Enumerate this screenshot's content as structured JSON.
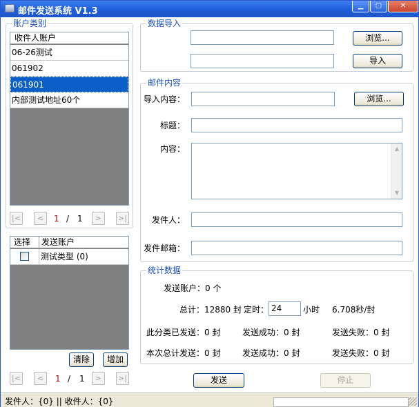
{
  "window": {
    "title": "邮件发送系统 V1.3",
    "controls": [
      "▁",
      "▢",
      "✕"
    ]
  },
  "account_category": {
    "label": "账户类别",
    "column": "收件人账户",
    "rows": [
      "06-26测试",
      "061902",
      "061901",
      "内部测试地址60个"
    ],
    "selected_index": 2,
    "pager": {
      "first": "|<",
      "prev": "<",
      "current": "1",
      "sep": "/",
      "total": "1",
      "next": ">",
      "last": ">|"
    }
  },
  "send_accounts": {
    "col_select": "选择",
    "col_account": "发送账户",
    "rows": [
      {
        "checked": false,
        "name": "测试类型 (0)"
      }
    ],
    "clear_label": "清除",
    "add_label": "增加",
    "pager": {
      "first": "|<",
      "prev": "<",
      "current": "1",
      "sep": "/",
      "total": "1",
      "next": ">",
      "last": ">|"
    }
  },
  "data_import": {
    "label": "数据导入",
    "field1": "",
    "field2": "",
    "browse_label": "浏览...",
    "import_label": "导入"
  },
  "mail_content": {
    "label": "邮件内容",
    "import_content_label": "导入内容：",
    "import_content": "",
    "browse_label": "浏览...",
    "subject_label": "标题：",
    "subject": "",
    "body_label": "内容：",
    "body": "",
    "sender_label": "发件人：",
    "sender": "",
    "sender_email_label": "发件邮箱：",
    "sender_email": ""
  },
  "stats": {
    "label": "统计数据",
    "send_accounts_text": "发送账户：0 个",
    "total_text": "总计：12880 封",
    "timer_label": "定时：",
    "timer_value": "24",
    "hours_label": "小时",
    "rate_text": "6.708秒/封",
    "row1": {
      "sent": "此分类已发送：0 封",
      "success": "发送成功：0 封",
      "fail": "发送失败：0 封"
    },
    "row2": {
      "sent": "本次总计发送：0 封",
      "success": "发送成功：0 封",
      "fail": "发送失败：0 封"
    }
  },
  "actions": {
    "send_label": "发送",
    "stop_label": "停止"
  },
  "status": {
    "text": "发件人：{0} || 收件人：{0}"
  }
}
